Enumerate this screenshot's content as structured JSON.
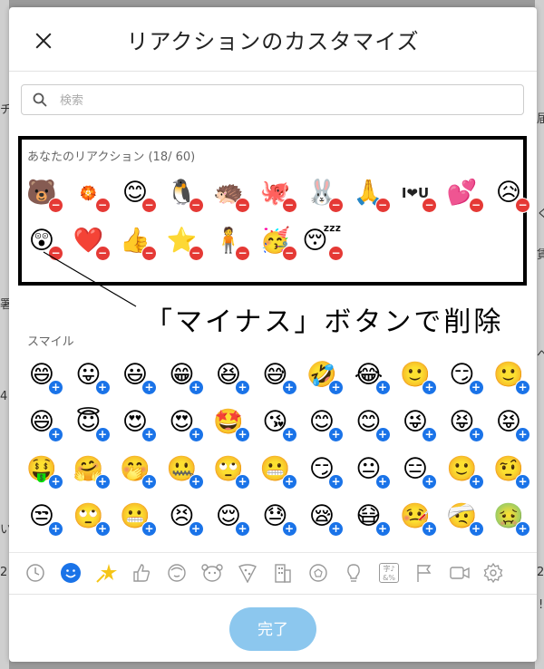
{
  "dialog": {
    "title": "リアクションのカスタマイズ",
    "close_icon": "close-icon",
    "search": {
      "placeholder": "検索",
      "value": ""
    },
    "your_reactions": {
      "label": "あなたのリアクション (18/ 60)",
      "items": [
        "🐻",
        "🏵️",
        "😊",
        "🐧",
        "🦔",
        "🐙",
        "🐰",
        "🙏",
        "I❤U",
        "💕",
        "😥",
        "😲",
        "❤️",
        "👍",
        "⭐",
        "🧍",
        "🥳",
        "😴"
      ]
    },
    "annotation": "「マイナス」ボタンで削除",
    "smile_section": {
      "label": "スマイル",
      "items": [
        "😄",
        "😛",
        "😃",
        "😁",
        "😆",
        "😅",
        "🤣",
        "😂",
        "🙂",
        "😏",
        "🙂",
        "😄",
        "😇",
        "😍",
        "😍",
        "🤩",
        "😘",
        "😊",
        "😊",
        "😜",
        "😝",
        "😝",
        "🤑",
        "🤗",
        "🤭",
        "🤐",
        "🙄",
        "😬",
        "😏",
        "😐",
        "😑",
        "🙂",
        "🤨",
        "😒",
        "🙄",
        "😬",
        "😣",
        "😌",
        "😓",
        "😪",
        "😷",
        "🤒",
        "🤕",
        "🤢"
      ]
    },
    "categories": [
      {
        "name": "recent",
        "icon": "clock-icon"
      },
      {
        "name": "smile",
        "icon": "smiley-icon",
        "active": true
      },
      {
        "name": "fun",
        "icon": "star-burst-icon"
      },
      {
        "name": "hands",
        "icon": "thumbs-up-icon"
      },
      {
        "name": "people",
        "icon": "face-icon"
      },
      {
        "name": "animals",
        "icon": "animal-icon"
      },
      {
        "name": "food",
        "icon": "pizza-icon"
      },
      {
        "name": "places",
        "icon": "building-icon"
      },
      {
        "name": "activities",
        "icon": "ball-icon"
      },
      {
        "name": "objects",
        "icon": "lightbulb-icon"
      },
      {
        "name": "symbols",
        "icon": "symbols-icon"
      },
      {
        "name": "flags",
        "icon": "flag-icon"
      },
      {
        "name": "video",
        "icon": "video-icon"
      },
      {
        "name": "settings",
        "icon": "gear-icon"
      }
    ],
    "symbols_glyph": "字♪&%",
    "done_label": "完了",
    "colors": {
      "accent": "#1a73e8",
      "remove": "#e53935",
      "done_bg": "#8cc7ee"
    }
  },
  "background": {
    "fragments": [
      "チ",
      "届",
      "く",
      "賃",
      "へ",
      "署",
      "4",
      "いさ",
      "2",
      "2",
      "!"
    ]
  }
}
